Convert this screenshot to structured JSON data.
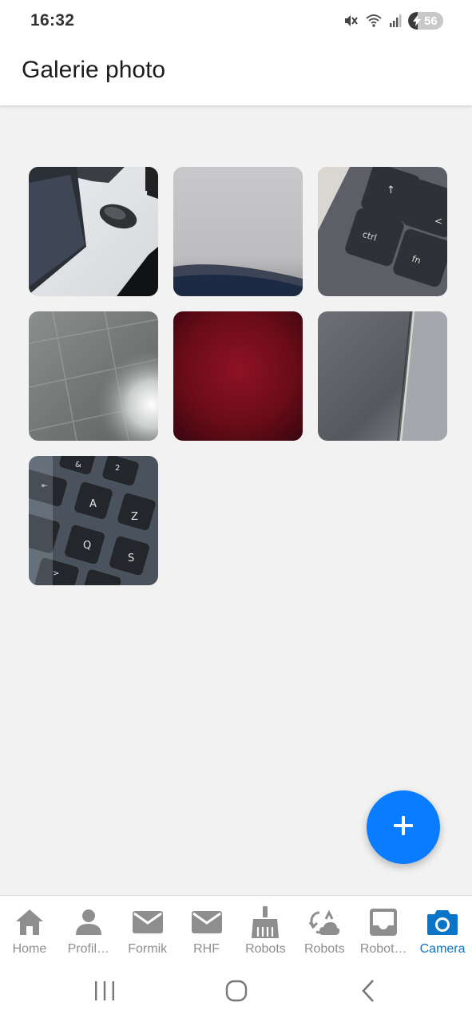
{
  "status_bar": {
    "time": "16:32",
    "battery_level": 56,
    "battery_label": "56",
    "icons": [
      "mute-icon",
      "wifi-icon",
      "signal-icon",
      "battery-icon"
    ]
  },
  "app_bar": {
    "title": "Galerie photo"
  },
  "gallery": {
    "photos": [
      {
        "subject": "laptop and mouse on desk"
      },
      {
        "subject": "grey blurred surface"
      },
      {
        "subject": "keyboard ctrl and fn keys"
      },
      {
        "subject": "grey floor tiles"
      },
      {
        "subject": "dark red blur"
      },
      {
        "subject": "grey laptop lid"
      },
      {
        "subject": "keyboard AZQS keys"
      }
    ]
  },
  "fab": {
    "icon": "plus-icon",
    "color": "#0a7cff"
  },
  "tabs": [
    {
      "label": "Home",
      "icon": "home-icon",
      "active": false
    },
    {
      "label": "Profil…",
      "icon": "person-icon",
      "active": false
    },
    {
      "label": "Formik",
      "icon": "mail-icon",
      "active": false
    },
    {
      "label": "RHF",
      "icon": "mail-icon",
      "active": false
    },
    {
      "label": "Robots",
      "icon": "broom-icon",
      "active": false
    },
    {
      "label": "Robots",
      "icon": "cloud-sync-icon",
      "active": false
    },
    {
      "label": "Robot…",
      "icon": "inbox-icon",
      "active": false
    },
    {
      "label": "Camera",
      "icon": "camera-icon",
      "active": true
    }
  ],
  "colors": {
    "accent": "#0a74c9",
    "inactive": "#8e8e8e",
    "background": "#f2f2f2"
  }
}
